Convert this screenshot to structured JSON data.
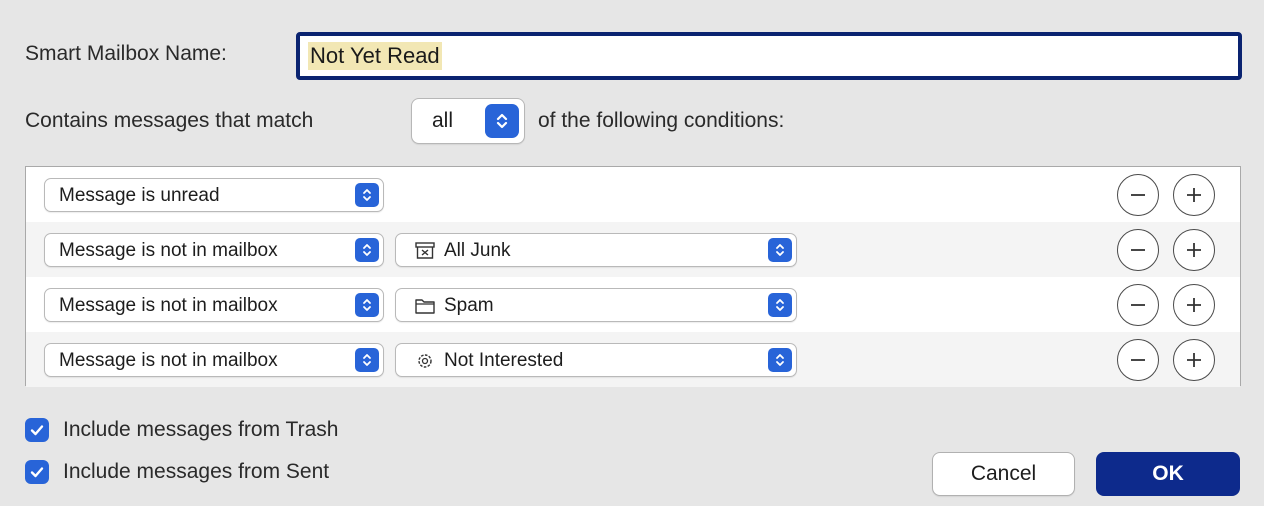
{
  "dialog": {
    "name_label": "Smart Mailbox Name:",
    "name_value": "Not Yet Read",
    "match_prefix": "Contains messages that match",
    "match_value": "all",
    "match_suffix": "of the following conditions:"
  },
  "conditions": [
    {
      "field": "Message is unread"
    },
    {
      "field": "Message is not in mailbox",
      "mailbox": "All Junk",
      "mailbox_icon": "junk-icon"
    },
    {
      "field": "Message is not in mailbox",
      "mailbox": "Spam",
      "mailbox_icon": "folder-icon"
    },
    {
      "field": "Message is not in mailbox",
      "mailbox": "Not Interested",
      "mailbox_icon": "smart-mailbox-gear-icon"
    }
  ],
  "options": {
    "include_trash_label": "Include messages from Trash",
    "include_trash_checked": true,
    "include_sent_label": "Include messages from Sent",
    "include_sent_checked": true
  },
  "buttons": {
    "cancel": "Cancel",
    "ok": "OK"
  },
  "colors": {
    "accent": "#2864d8",
    "default_button": "#0d2a8c",
    "focus_ring": "#0a2370",
    "selection_highlight": "#f2e7b4",
    "dialog_background": "#e6e6e6"
  }
}
